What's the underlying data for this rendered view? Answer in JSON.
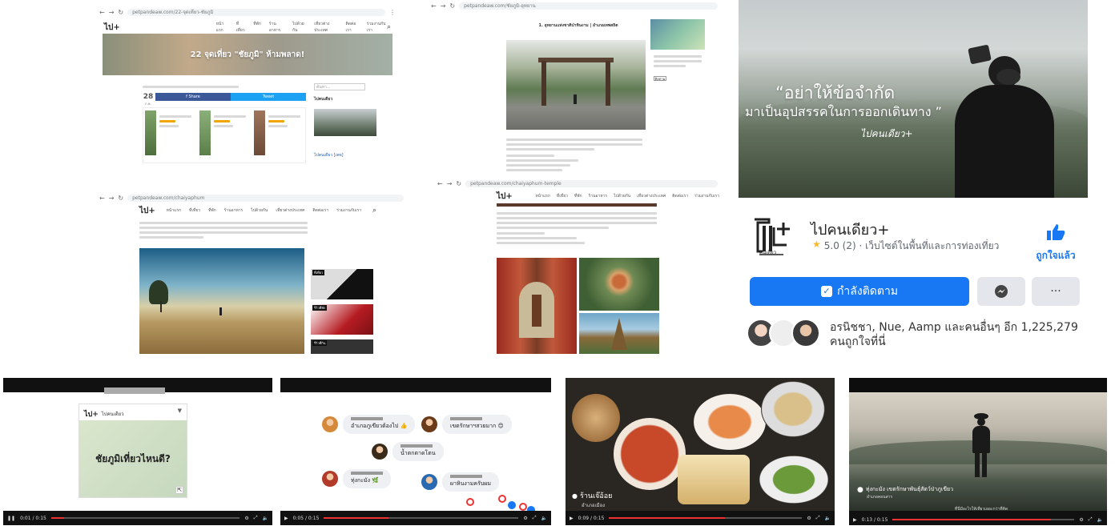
{
  "shot1": {
    "url": "petpandeaw.com/22-จุดเที่ยว-ชัยภูมิ",
    "logo": "ไป+",
    "nav": [
      "หน้าแรก",
      "ที่เที่ยว",
      "ที่พัก",
      "ร้านอาหาร",
      "ไปด้วยกัน",
      "เที่ยวต่างประเทศ",
      "ติดต่อเรา",
      "ร่วมงานกับเรา"
    ],
    "hero_title": "22 จุดเที่ยว \"ชัยภูมิ\" ห้ามพลาด!",
    "date_day": "28",
    "date_month": "ก.ค.",
    "share_fb": "f Share",
    "share_tw": "Tweet",
    "search_placeholder": "ค้นหา...",
    "sidebar_heading": "ไปคนเดียว",
    "sidebar_link": "ไปคนเดียว [เพจ]"
  },
  "shot2": {
    "url": "petpandeaw.com/ชัยภูมิ-อุทยาน",
    "heading": "1. อุทยานแห่งชาติป่าหินงาม | อำเภอเทพสถิต",
    "sidebar_btn": "ติดตาม"
  },
  "shot3": {
    "url": "petpandeaw.com/chaiyaphum",
    "logo": "ไป+",
    "nav": [
      "หน้าแรก",
      "ที่เที่ยว",
      "ที่พัก",
      "ร้านอาหาร",
      "ไปด้วยกัน",
      "เที่ยวต่างประเทศ",
      "ติดต่อเรา",
      "ร่วมงานกับเรา"
    ],
    "card_labels": [
      "ที่เที่ยว",
      "รีวิวที่พัก",
      "รีวิวที่กิน"
    ]
  },
  "shot4": {
    "url": "petpandeaw.com/chaiyaphum-temple",
    "logo": "ไป+",
    "nav": [
      "หน้าแรก",
      "ที่เที่ยว",
      "ที่พัก",
      "ร้านอาหาร",
      "ไปด้วยกัน",
      "เที่ยวต่างประเทศ",
      "ติดต่อเรา",
      "ร่วมงานกับเรา"
    ]
  },
  "fbpage": {
    "quote_line1": "“อย่าให้ข้อจำกัด",
    "quote_line2": "มาเป็นอุปสรรคในการออกเดินทาง ”",
    "signature": "ไปคนเดียว+",
    "page_name": "ไปคนเดียว+",
    "rating": "5.0 (2) · เว็บไซต์ในพื้นที่และการท่องเที่ยว",
    "liked_label": "ถูกใจแล้ว",
    "following_label": "กำลังติดตาม",
    "more_label": "···",
    "friends_line1": "อรนิชชา, Nue, Aamp และคนอื่นๆ อีก 1,225,279",
    "friends_line2": "คนถูกใจที่นี่",
    "logo_caption": "คนเดียว",
    "colors": {
      "primary": "#1877f2",
      "rating": "#f7b928"
    }
  },
  "video1": {
    "page_name": "ไปคนเดียว",
    "question": "ชัยภูมิเที่ยวไหนดี?",
    "time": "0:01 / 0:15"
  },
  "video2": {
    "comments": [
      "อำเภอภูเขียวต้องไป 👍",
      "เขตรักษาฯสวยมาก 😊",
      "น้ำตกตาดโตน",
      "ทุ่งกะมัง 🌿",
      "ผาหินงามครับผม"
    ],
    "time": "0:05 / 0:15"
  },
  "video3": {
    "location": "ร้านเจ๊อ้อย",
    "sublocation": "อำเภอเมือง",
    "time": "0:09 / 0:15"
  },
  "video4": {
    "location": "ทุ่งกะมัง เขตรักษาพันธุ์สัตว์ป่าภูเขียว",
    "sublocation": "อำเภอคอนสาร",
    "subtitle": "ที่นี่มีอะไรให้เที่ยวเยอะกว่าที่คิด",
    "time": "0:13 / 0:15"
  }
}
